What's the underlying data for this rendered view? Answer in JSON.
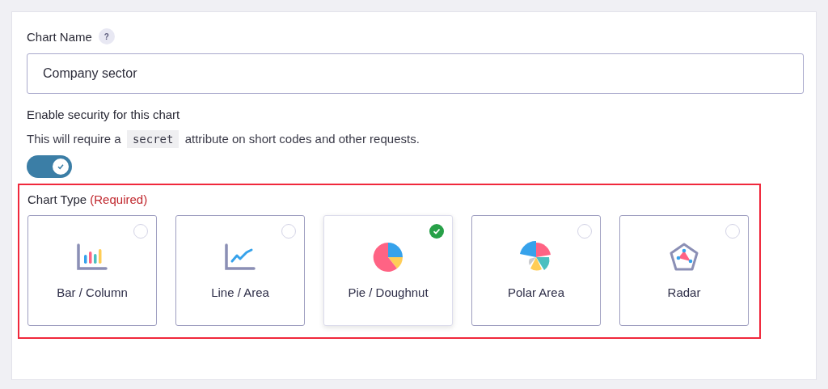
{
  "chart_name": {
    "label": "Chart Name",
    "help": "?",
    "value": "Company sector"
  },
  "security": {
    "label": "Enable security for this chart",
    "description_before": "This will require a",
    "description_code": "secret",
    "description_after": "attribute on short codes and other requests.",
    "on": true
  },
  "chart_type": {
    "label": "Chart Type",
    "required": "(Required)",
    "highlighted": true,
    "options": [
      {
        "kind": "bar",
        "label": "Bar / Column",
        "selected": false
      },
      {
        "kind": "line",
        "label": "Line / Area",
        "selected": false
      },
      {
        "kind": "pie",
        "label": "Pie / Doughnut",
        "selected": true
      },
      {
        "kind": "polar",
        "label": "Polar Area",
        "selected": false
      },
      {
        "kind": "radar",
        "label": "Radar",
        "selected": false
      }
    ]
  }
}
